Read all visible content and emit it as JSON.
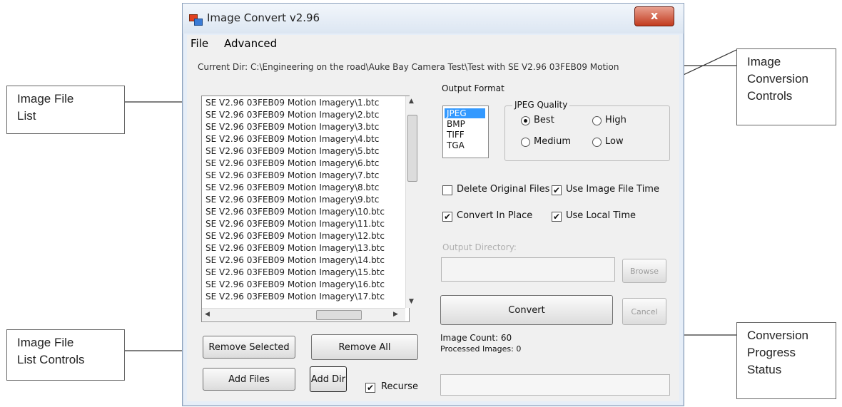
{
  "window": {
    "title": "Image Convert v2.96",
    "close_glyph": "x",
    "menu": [
      "File",
      "Advanced"
    ]
  },
  "current_dir": "Current Dir: C:\\Engineering on the road\\Auke Bay Camera Test\\Test with SE V2.96 03FEB09 Motion",
  "file_list": [
    "SE V2.96 03FEB09 Motion Imagery\\1.btc",
    "SE V2.96 03FEB09 Motion Imagery\\2.btc",
    "SE V2.96 03FEB09 Motion Imagery\\3.btc",
    "SE V2.96 03FEB09 Motion Imagery\\4.btc",
    "SE V2.96 03FEB09 Motion Imagery\\5.btc",
    "SE V2.96 03FEB09 Motion Imagery\\6.btc",
    "SE V2.96 03FEB09 Motion Imagery\\7.btc",
    "SE V2.96 03FEB09 Motion Imagery\\8.btc",
    "SE V2.96 03FEB09 Motion Imagery\\9.btc",
    "SE V2.96 03FEB09 Motion Imagery\\10.btc",
    "SE V2.96 03FEB09 Motion Imagery\\11.btc",
    "SE V2.96 03FEB09 Motion Imagery\\12.btc",
    "SE V2.96 03FEB09 Motion Imagery\\13.btc",
    "SE V2.96 03FEB09 Motion Imagery\\14.btc",
    "SE V2.96 03FEB09 Motion Imagery\\15.btc",
    "SE V2.96 03FEB09 Motion Imagery\\16.btc",
    "SE V2.96 03FEB09 Motion Imagery\\17.btc"
  ],
  "list_controls": {
    "remove_selected": "Remove Selected",
    "remove_all": "Remove All",
    "add_files": "Add Files",
    "add_dir": "Add Dir",
    "recurse_label": "Recurse",
    "recurse_checked": true
  },
  "output_format": {
    "label": "Output Format",
    "options": [
      "JPEG",
      "BMP",
      "TIFF",
      "TGA"
    ],
    "selected": "JPEG"
  },
  "jpeg_quality": {
    "legend": "JPEG Quality",
    "options": [
      "Best",
      "High",
      "Medium",
      "Low"
    ],
    "selected": "Best"
  },
  "options": {
    "delete_original": {
      "label": "Delete Original Files",
      "checked": false
    },
    "use_image_file_time": {
      "label": "Use Image File Time",
      "checked": true
    },
    "convert_in_place": {
      "label": "Convert In Place",
      "checked": true
    },
    "use_local_time": {
      "label": "Use Local Time",
      "checked": true
    }
  },
  "output_directory": {
    "label": "Output Directory:",
    "value": "",
    "browse": "Browse"
  },
  "actions": {
    "convert": "Convert",
    "cancel": "Cancel"
  },
  "status": {
    "image_count": "Image Count: 60",
    "processed": "Processed Images: 0",
    "progress": 0
  },
  "annotations": {
    "image_file_list": [
      "Image File",
      "List"
    ],
    "image_conversion_controls": [
      "Image",
      "Conversion",
      "Controls"
    ],
    "image_file_list_controls": [
      "Image File",
      "List Controls"
    ],
    "conversion_progress_status": [
      "Conversion",
      "Progress",
      "Status"
    ]
  },
  "colors": {
    "selection": "#3399ff",
    "window_frame": "#8da2bd",
    "close_button": "#c23a1e"
  }
}
